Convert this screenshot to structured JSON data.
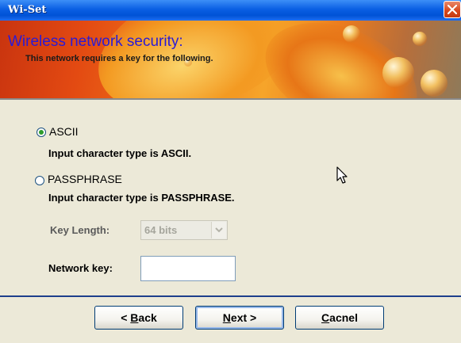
{
  "window": {
    "title": "Wi-Set"
  },
  "banner": {
    "heading": "Wireless network security:",
    "subheading": "This network requires a key for the following."
  },
  "options": [
    {
      "label": "ASCII",
      "description": "Input character type is ASCII.",
      "selected": true
    },
    {
      "label": "PASSPHRASE",
      "description": "Input character type is PASSPHRASE.",
      "selected": false
    }
  ],
  "key_length": {
    "label": "Key Length:",
    "value": "64 bits",
    "enabled": false
  },
  "network_key": {
    "label": "Network key:",
    "value": ""
  },
  "buttons": {
    "back": {
      "prefix": "< ",
      "mnemonic": "B",
      "rest": "ack"
    },
    "next": {
      "mnemonic": "N",
      "rest": "ext >"
    },
    "cancel": {
      "mnemonic": "C",
      "rest": "acnel"
    }
  },
  "colors": {
    "title_bar": "#0a5fe3",
    "heading_text": "#2a1bd6",
    "radio_selected": "#2d9b2d",
    "close_button": "#d9491f"
  },
  "icons": {
    "close": "close-icon",
    "dropdown": "chevron-down-icon",
    "cursor": "mouse-pointer-icon"
  }
}
